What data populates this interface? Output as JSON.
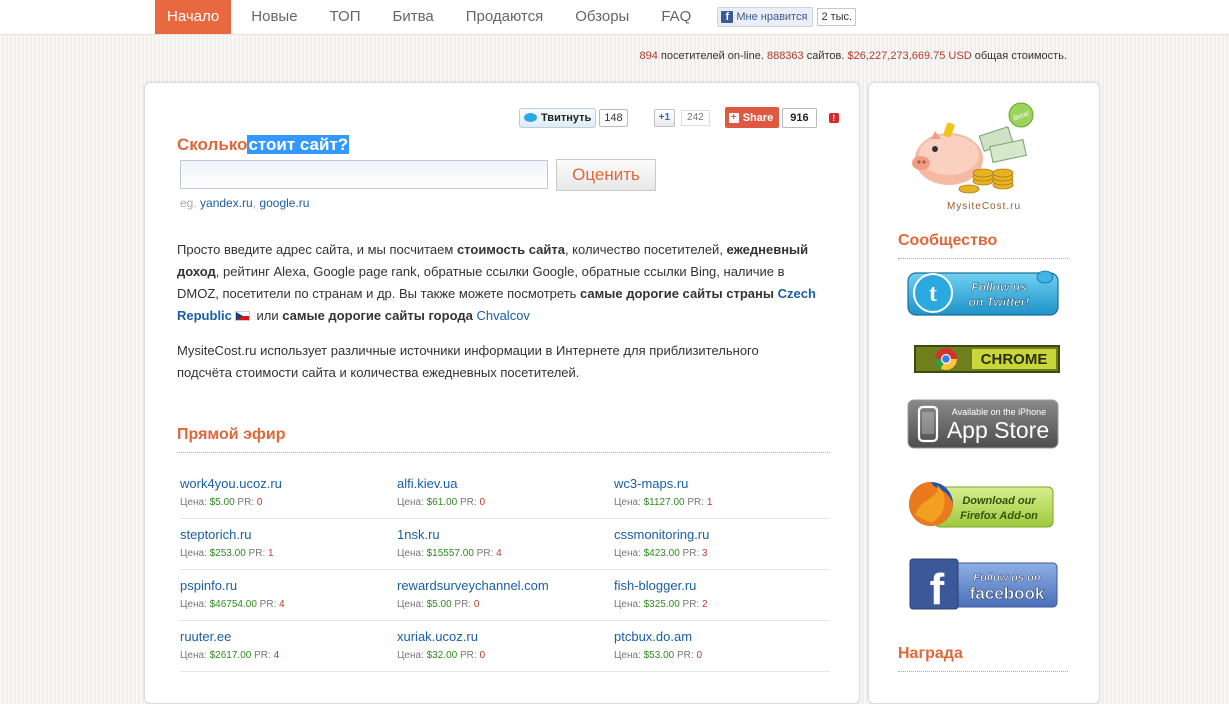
{
  "nav": {
    "items": [
      {
        "label": "Начало",
        "active": true
      },
      {
        "label": "Новые"
      },
      {
        "label": "ТОП"
      },
      {
        "label": "Битва"
      },
      {
        "label": "Продаются"
      },
      {
        "label": "Обзоры"
      },
      {
        "label": "FAQ"
      }
    ],
    "fb_like_label": "Мне нравится",
    "fb_like_count": "2 тыс."
  },
  "stats": {
    "visitors": "894",
    "visitors_label": "посетителей on-line.",
    "sites": "888363",
    "sites_label": "сайтов.",
    "value": "$26,227,273,669.75 USD",
    "value_label": "общая стоимость."
  },
  "share": {
    "tweet_label": "Твитнуть",
    "tweet_count": "148",
    "gplus_label": "+1",
    "gplus_count": "242",
    "share_label": "Share",
    "share_count": "916"
  },
  "hero": {
    "title_plain": "Сколько",
    "title_highlight": "стоит сайт?",
    "button_label": "Оценить",
    "examples_prefix": "eg.",
    "example_1": "yandex.ru",
    "example_sep": ",",
    "example_2": "google.ru"
  },
  "desc": {
    "p1_a": "Просто введите адрес сайта, и мы посчитаем ",
    "p1_b": "стоимость сайта",
    "p1_c": ", количество посетителей, ",
    "p1_d": "ежедневный доход",
    "p1_e": ", рейтинг Alexa, Google page rank, обратные ссылки Google, обратные ссылки Bing, наличие в DMOZ, посетители по странам и др. Вы также можете посмотреть ",
    "p1_f": "самые дорогие сайты страны",
    "p1_country": "Czech Republic",
    "p1_g": " или ",
    "p1_h": "самые дорогие сайты города",
    "p1_city": "Chvalcov",
    "p2": "MysiteCost.ru использует различные источники информации в Интернете для приблизительного подсчёта стоимости сайта и количества ежедневных посетителей."
  },
  "live": {
    "title": "Прямой эфир",
    "price_label": "Цена:",
    "pr_label": "PR:",
    "sites": [
      {
        "site": "work4you.ucoz.ru",
        "price": "$5.00",
        "pr": "0"
      },
      {
        "site": "alfi.kiev.ua",
        "price": "$61.00",
        "pr": "0"
      },
      {
        "site": "wc3-maps.ru",
        "price": "$1127.00",
        "pr": "1"
      },
      {
        "site": "steptorich.ru",
        "price": "$253.00",
        "pr": "1"
      },
      {
        "site": "1nsk.ru",
        "price": "$15557.00",
        "pr": "4"
      },
      {
        "site": "cssmonitoring.ru",
        "price": "$423.00",
        "pr": "3"
      },
      {
        "site": "pspinfo.ru",
        "price": "$46754.00",
        "pr": "4"
      },
      {
        "site": "rewardsurveychannel.com",
        "price": "$5.00",
        "pr": "0"
      },
      {
        "site": "fish-blogger.ru",
        "price": "$325.00",
        "pr": "2"
      },
      {
        "site": "ruuter.ee",
        "price": "$2617.00",
        "pr": "4"
      },
      {
        "site": "xuriak.ucoz.ru",
        "price": "$32.00",
        "pr": "0"
      },
      {
        "site": "ptcbux.do.am",
        "price": "$53.00",
        "pr": "0"
      }
    ]
  },
  "sidebar": {
    "logo_text": "MysiteCost.ru",
    "beta": "Beta!",
    "community_title": "Сообщество",
    "twitter_line1": "Follow us",
    "twitter_line2": "on Twitter!",
    "chrome_label": "CHROME",
    "appstore_small": "Available on the iPhone",
    "appstore_big": "App Store",
    "firefox_line1": "Download our",
    "firefox_line2": "Firefox Add-on",
    "facebook_line1": "Follow us on",
    "facebook_line2": "facebook",
    "award_title": "Награда"
  }
}
